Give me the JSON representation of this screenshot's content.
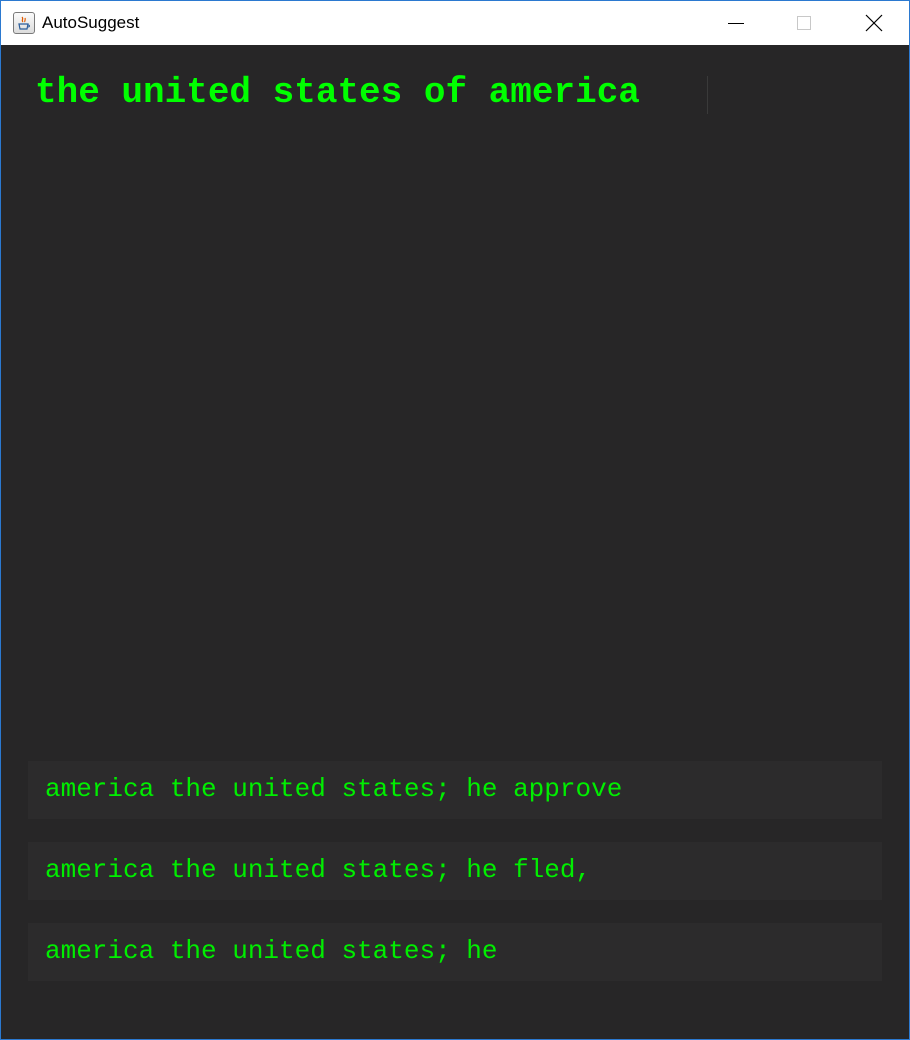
{
  "window": {
    "title": "AutoSuggest",
    "icons": {
      "app": "java-app-icon",
      "minimize": "minimize-icon",
      "maximize": "maximize-icon",
      "close": "close-icon"
    }
  },
  "input": {
    "value": "the united states of america"
  },
  "suggestions": [
    {
      "text": "america the united states; he approve"
    },
    {
      "text": "america the united states; he fled,"
    },
    {
      "text": "america the united states; he"
    }
  ],
  "colors": {
    "background": "#272627",
    "text": "#00ff00",
    "suggestion_bg": "#2c2b2c"
  }
}
